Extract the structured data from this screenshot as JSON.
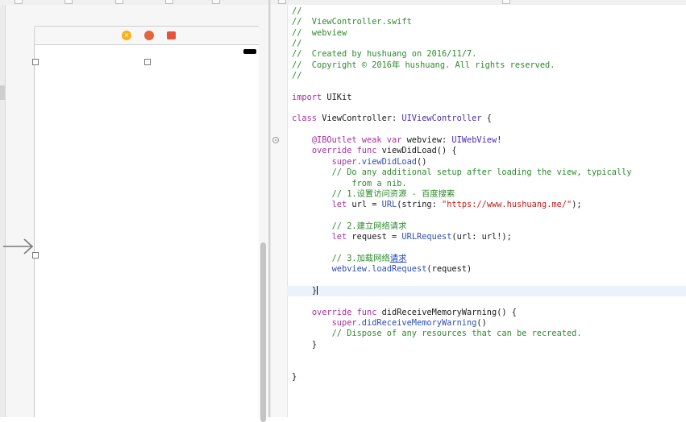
{
  "colors": {
    "comment": "#2d8a2d",
    "keyword": "#a8309c",
    "type": "#4b2bb0",
    "function": "#2f4fb5",
    "string": "#c41a16",
    "current_line": "#eaf2fb"
  },
  "scene_bar": {
    "icons": [
      "view-controller-icon",
      "first-responder-icon",
      "exit-icon"
    ]
  },
  "editor": {
    "lines": {
      "l1": "//",
      "l2": "//  ViewController.swift",
      "l3": "//  webview",
      "l4": "//",
      "l5": "//  Created by hushuang on 2016/11/7.",
      "l6": "//  Copyright © 2016年 hushuang. All rights reserved.",
      "l7": "//",
      "l9_kw": "import",
      "l9_rest": " UIKit",
      "l11_kw": "class",
      "l11_name": " ViewController: ",
      "l11_type": "UIViewController",
      "l11_end": " {",
      "l13_attr": "@IBOutlet",
      "l13_kw": " weak var",
      "l13_name": " webview: ",
      "l13_type": "UIWebView",
      "l13_end": "!",
      "l14_kw": "override func",
      "l14_rest": " viewDidLoad() {",
      "l15_kw": "super",
      "l15_fn": ".viewDidLoad",
      "l15_end": "()",
      "l16": "// Do any additional setup after loading the view, typically",
      "l17": "    from a nib.",
      "l18": "// 1.设置访问资源 - 百度搜索",
      "l19_kw": "let",
      "l19_var": " url = ",
      "l19_fn": "URL",
      "l19_mid": "(string: ",
      "l19_str": "\"https://www.hushuang.me/\"",
      "l19_end": ");",
      "l21": "// 2.建立网络请求",
      "l22_kw": "let",
      "l22_var": " request = ",
      "l22_fn": "URLRequest",
      "l22_end": "(url: url!);",
      "l24_prefix": "// 3.加载网络",
      "l24_link": "请求",
      "l25_var": "webview",
      "l25_fn": ".loadRequest",
      "l25_end": "(request)",
      "l27": "}",
      "l29_kw": "override func",
      "l29_rest": " didReceiveMemoryWarning() {",
      "l30_kw": "super",
      "l30_fn": ".didReceiveMemoryWarning",
      "l30_end": "()",
      "l31": "// Dispose of any resources that can be recreated.",
      "l32": "}",
      "l35": "}"
    }
  }
}
